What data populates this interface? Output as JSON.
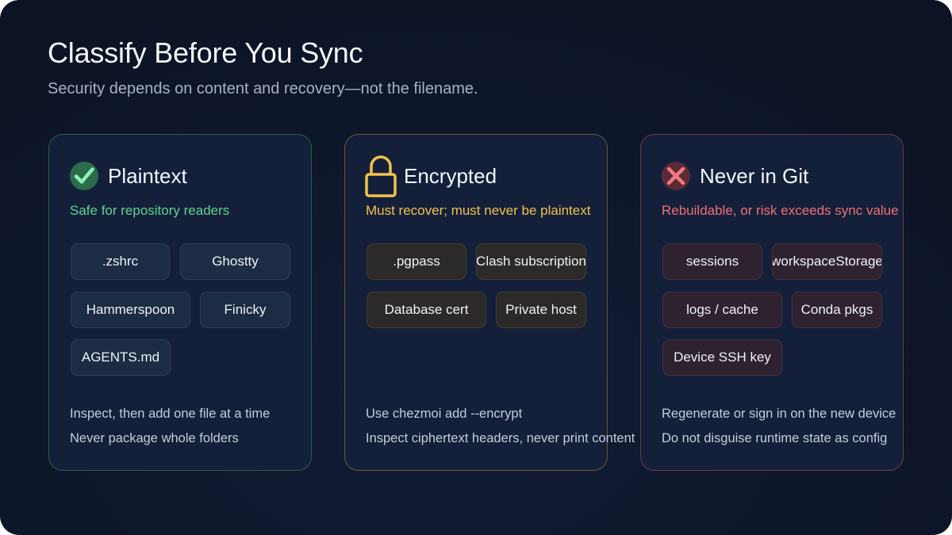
{
  "title": "Classify Before You Sync",
  "subtitle": "Security depends on content and recovery—not the filename.",
  "colors": {
    "background": "#0f172c",
    "card_background": "#14203a",
    "green_accent": "#5fd38f",
    "amber_accent": "#f1c14b",
    "red_accent": "#ef6f73"
  },
  "cards": [
    {
      "icon": "check-circle-icon",
      "title": "Plaintext",
      "tagline": "Safe for repository readers",
      "chips": [
        ".zshrc",
        "Ghostty",
        "Hammerspoon",
        "Finicky",
        "AGENTS.md"
      ],
      "notes": [
        "Inspect, then add one file at a time",
        "Never package whole folders"
      ]
    },
    {
      "icon": "padlock-icon",
      "title": "Encrypted",
      "tagline": "Must recover; must never be plaintext",
      "chips": [
        ".pgpass",
        "Clash subscription",
        "Database cert",
        "Private host"
      ],
      "notes": [
        "Use chezmoi add --encrypt",
        "Inspect ciphertext headers, never print content"
      ]
    },
    {
      "icon": "x-circle-icon",
      "title": "Never in Git",
      "tagline": "Rebuildable, or risk exceeds sync value",
      "chips": [
        "sessions",
        "workspaceStorage",
        "logs / cache",
        "Conda pkgs",
        "Device SSH key"
      ],
      "notes": [
        "Regenerate or sign in on the new device",
        "Do not disguise runtime state as config"
      ]
    }
  ]
}
